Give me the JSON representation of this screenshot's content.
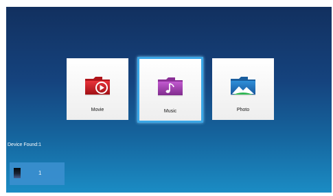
{
  "media_menu": {
    "tiles": [
      {
        "label": "Movie",
        "icon": "movie-folder-icon",
        "color": "#c8161d",
        "selected": false
      },
      {
        "label": "Music",
        "icon": "music-folder-icon",
        "color": "#9b3ea6",
        "selected": true
      },
      {
        "label": "Photo",
        "icon": "photo-folder-icon",
        "color": "#1a6bb0",
        "selected": false
      }
    ]
  },
  "devices": {
    "status_text": "Device Found:1",
    "items": [
      {
        "label": "1",
        "icon": "storage-device-icon"
      }
    ]
  },
  "colors": {
    "selection_border": "#3aa6e6",
    "background_top": "#12305f",
    "background_bottom": "#1b8cc4"
  }
}
